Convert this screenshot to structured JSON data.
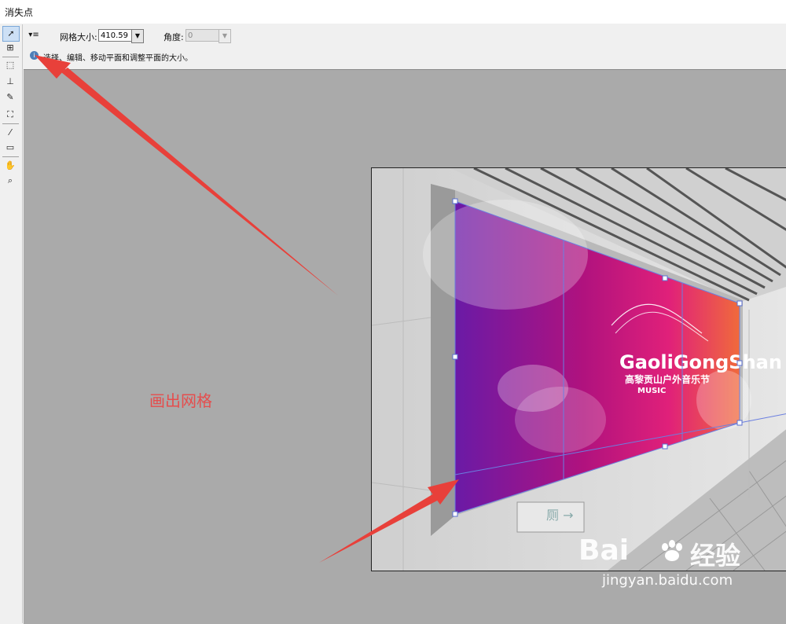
{
  "window": {
    "title": "消失点"
  },
  "options_bar": {
    "grid_size_label": "网格大小:",
    "grid_size_value": "410.59",
    "angle_label": "角度:",
    "angle_value": "0"
  },
  "hint": {
    "text": "选择、编辑、移动平面和调整平面的大小。"
  },
  "tools": [
    {
      "name": "edit-plane-tool",
      "glyph": "➚",
      "active": true
    },
    {
      "name": "create-plane-tool",
      "glyph": "⊞"
    },
    {
      "name": "marquee-tool",
      "glyph": "⬚"
    },
    {
      "name": "stamp-tool",
      "glyph": "⊥"
    },
    {
      "name": "brush-tool",
      "glyph": "✎"
    },
    {
      "name": "transform-tool",
      "glyph": "⛶"
    },
    {
      "name": "eyedropper-tool",
      "glyph": "⁄"
    },
    {
      "name": "measure-tool",
      "glyph": "▭"
    },
    {
      "name": "hand-tool",
      "glyph": "✋"
    },
    {
      "name": "zoom-tool",
      "glyph": "⌕"
    }
  ],
  "annotation": {
    "text": "画出网格"
  },
  "poster": {
    "brand": "GaoliGongShan",
    "subtitle": "高黎贡山户外音乐节",
    "music": "MUSIC"
  },
  "sign": {
    "text": "厕 →"
  },
  "watermark": {
    "logo": "Bai",
    "cn": "经验",
    "url": "jingyan.baidu.com"
  },
  "colors": {
    "arrow": "#e8403a",
    "grid_line": "#6b7fe0",
    "annotation": "#e54d4d",
    "poster_left": "#6a1aa6",
    "poster_right": "#f06a3c"
  }
}
